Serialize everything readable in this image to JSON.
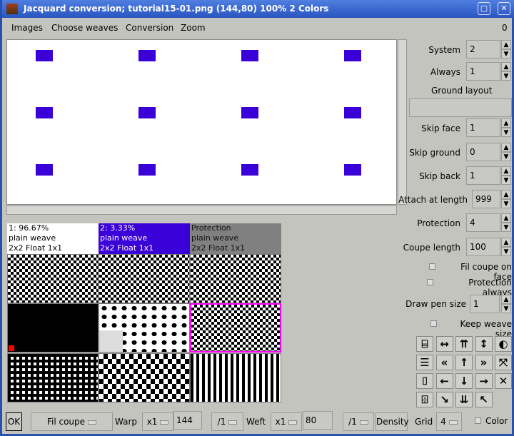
{
  "window": {
    "title": "Jacquard conversion; tutorial15-01.png (144,80) 100% 2 Colors"
  },
  "menu": {
    "items": [
      "Images",
      "Choose weaves",
      "Conversion",
      "Zoom"
    ],
    "right_value": "0"
  },
  "colors": {
    "accent": "#3a00d8",
    "protection": "#808080",
    "selection": "#ff00ff",
    "marker": "#ff0000"
  },
  "weaves": [
    {
      "line1": "1: 96.67%",
      "line2": "plain weave",
      "line3": "2x2 Float 1x1"
    },
    {
      "line1": "2: 3.33%",
      "line2": "plain weave",
      "line3": "2x2 Float 1x1"
    },
    {
      "line1": "Protection",
      "line2": "plain weave",
      "line3": "2x2 Float 1x1"
    }
  ],
  "panel": {
    "system": {
      "label": "System",
      "value": "2"
    },
    "always": {
      "label": "Always",
      "value": "1"
    },
    "ground_layout": {
      "label": "Ground layout",
      "value": ""
    },
    "skip_face": {
      "label": "Skip face",
      "value": "1"
    },
    "skip_ground": {
      "label": "Skip ground",
      "value": "0"
    },
    "skip_back": {
      "label": "Skip back",
      "value": "1"
    },
    "attach": {
      "label": "Attach at length",
      "value": "999"
    },
    "protection": {
      "label": "Protection",
      "value": "4"
    },
    "coupe": {
      "label": "Coupe length",
      "value": "100"
    },
    "fil_coupe_face": "Fil coupe on face",
    "protection_always": "Protection always",
    "pen": {
      "label": "Draw pen size",
      "value": "1"
    },
    "keep_weave": "Keep weave size",
    "icons": [
      "stairs-up",
      "move-horizontal",
      "double-arrow-up",
      "move-vertical",
      "invert",
      "stairs-down",
      "double-arrow-left",
      "arrow-up",
      "double-arrow-right",
      "diagonal-cross",
      "stairs-right",
      "arrow-left",
      "arrow-down",
      "arrow-right",
      "cross",
      "stairs-left",
      "fill-down-right",
      "double-arrow-down",
      "fill-up-left"
    ]
  },
  "bottom": {
    "ok": "OK",
    "mode": "Fil coupe",
    "warp_label": "Warp",
    "warp_mult": "x1",
    "warp_value": "144",
    "warp_div": "/1",
    "weft_label": "Weft",
    "weft_mult": "x1",
    "weft_value": "80",
    "weft_div": "/1",
    "density": "Density",
    "grid_label": "Grid",
    "grid_value": "4",
    "color_label": "Color"
  }
}
